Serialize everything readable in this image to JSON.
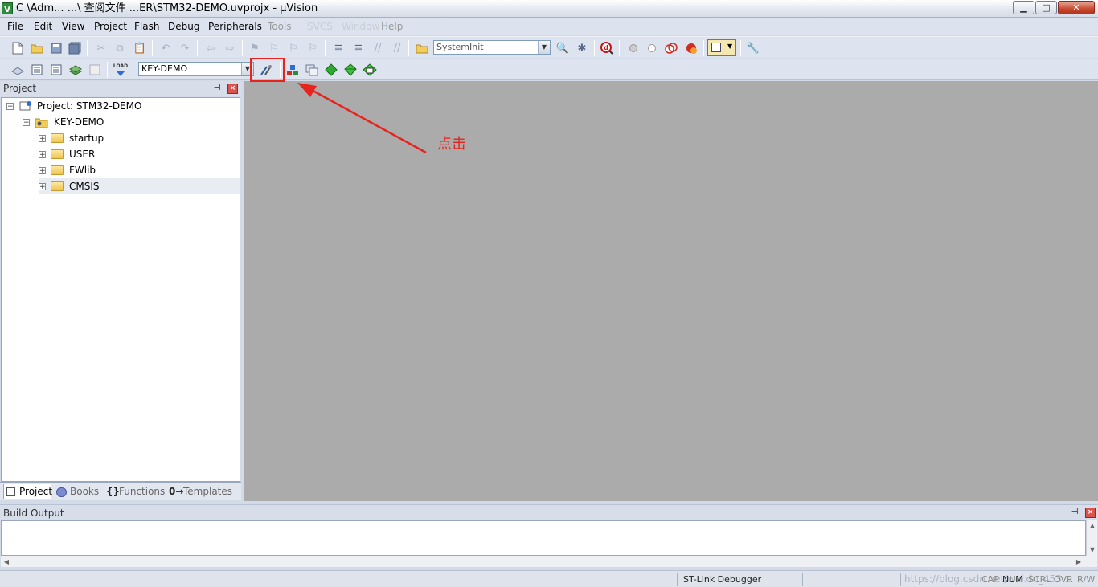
{
  "window": {
    "title": "C          \\Adm...                        ...\\ 查阅文件 ...ER\\STM32-DEMO.uvprojx - µVision",
    "app_icon": "V",
    "minimize": "▁",
    "maximize": "□",
    "close": "✕"
  },
  "menu": [
    "File",
    "Edit",
    "View",
    "Project",
    "Flash",
    "Debug",
    "Peripherals",
    "Tools",
    "SVCS",
    "Window",
    "Help"
  ],
  "toolbar": {
    "function_combo": "SystemInit",
    "target_combo": "KEY-DEMO",
    "load_label": "LOAD"
  },
  "project_panel": {
    "title": "Project",
    "pin": "⊣",
    "close": "×",
    "root": "Project: STM32-DEMO",
    "target": "KEY-DEMO",
    "groups": [
      "startup",
      "USER",
      "FWlib",
      "CMSIS"
    ],
    "tabs": [
      "Project",
      "Books",
      "Functions",
      "Templates"
    ]
  },
  "build_output": {
    "title": "Build Output",
    "pin": "⊣",
    "close": "×"
  },
  "statusbar": {
    "debugger": "ST-Link Debugger",
    "cap": "CAP",
    "num": "NUM",
    "scrl": "SCRL",
    "ovr": "OVR",
    "rw": "R/W",
    "watermark": "https://blog.csdn.net/weixin_453..."
  },
  "annotation": {
    "label": "点击",
    "color": "#e8221c"
  }
}
